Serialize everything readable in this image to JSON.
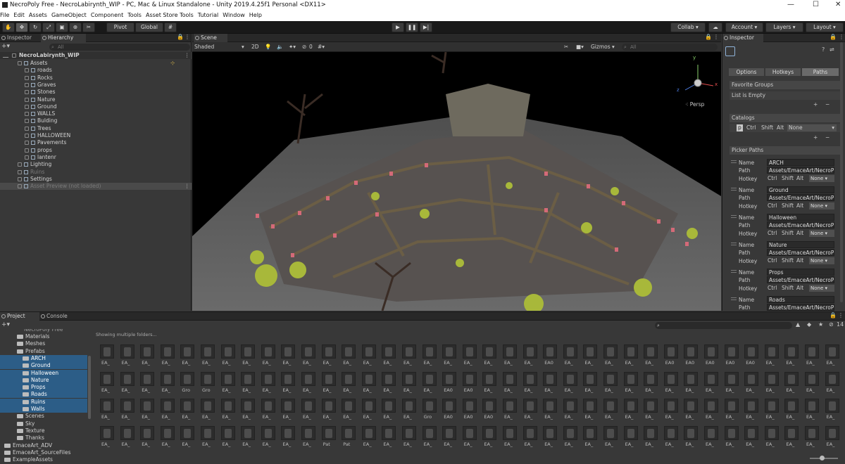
{
  "window": {
    "title": "NecroPoly Free - NecroLabirynth_WIP - PC, Mac & Linux Standalone - Unity 2019.4.25f1 Personal <DX11>"
  },
  "menu": [
    "File",
    "Edit",
    "Assets",
    "GameObject",
    "Component",
    "Tools",
    "Asset Store Tools",
    "Tutorial",
    "Window",
    "Help"
  ],
  "toolbar": {
    "pivot": "Pivot",
    "global": "Global",
    "collab": "Collab",
    "account": "Account",
    "layers": "Layers",
    "layout": "Layout"
  },
  "hierarchy": {
    "tabs": [
      "Inspector",
      "Hierarchy"
    ],
    "search_placeholder": "All",
    "scene": "NecroLabirynth_WIP",
    "items": [
      {
        "label": "Assets",
        "depth": 1
      },
      {
        "label": "roads",
        "depth": 2
      },
      {
        "label": "Rocks",
        "depth": 2
      },
      {
        "label": "Graves",
        "depth": 2
      },
      {
        "label": "Stones",
        "depth": 2
      },
      {
        "label": "Nature",
        "depth": 2
      },
      {
        "label": "Ground",
        "depth": 2
      },
      {
        "label": "WALLS",
        "depth": 2
      },
      {
        "label": "Bulding",
        "depth": 2
      },
      {
        "label": "Trees",
        "depth": 2
      },
      {
        "label": "HALLOWEEN",
        "depth": 2
      },
      {
        "label": "Pavements",
        "depth": 2
      },
      {
        "label": "props",
        "depth": 2
      },
      {
        "label": "lantenr",
        "depth": 2
      },
      {
        "label": "Lighting",
        "depth": 1
      },
      {
        "label": "Ruins",
        "depth": 1
      },
      {
        "label": "Settings",
        "depth": 1
      },
      {
        "label": "Asset Preview (not loaded)",
        "depth": 1
      }
    ]
  },
  "scene": {
    "tab": "Scene",
    "shading": "Shaded",
    "mode2d": "2D",
    "hidden_count": "0",
    "gizmos": "Gizmos",
    "search_placeholder": "All",
    "persp": "Persp",
    "axes": {
      "x": "x",
      "y": "y",
      "z": "z"
    }
  },
  "inspector": {
    "tab": "Inspector",
    "tabs": [
      "Options",
      "Hotkeys",
      "Paths"
    ],
    "favorite_groups": "Favorite Groups",
    "list_empty": "List is Empty",
    "catalogs": "Catalogs",
    "catalog_row": {
      "p": "p",
      "ctrl": "Ctrl",
      "shift": "Shift",
      "alt": "Alt",
      "none": "None"
    },
    "picker_paths": "Picker Paths",
    "labels": {
      "name": "Name",
      "path": "Path",
      "hotkey": "Hotkey"
    },
    "paths": [
      {
        "name": "ARCH",
        "path": "Assets/EmaceArt/NecroP"
      },
      {
        "name": "Ground",
        "path": "Assets/EmaceArt/NecroP"
      },
      {
        "name": "Halloween",
        "path": "Assets/EmaceArt/NecroP"
      },
      {
        "name": "Nature",
        "path": "Assets/EmaceArt/NecroP"
      },
      {
        "name": "Props",
        "path": "Assets/EmaceArt/NecroP"
      },
      {
        "name": "Roads",
        "path": "Assets/EmaceArt/NecroP"
      }
    ],
    "plus": "+",
    "minus": "−"
  },
  "project": {
    "tabs": [
      "Project",
      "Console"
    ],
    "status": "Showing multiple folders...",
    "count": "14",
    "tree": [
      {
        "label": "Materials",
        "depth": 3,
        "sel": false
      },
      {
        "label": "Meshes",
        "depth": 3,
        "sel": false
      },
      {
        "label": "Prefabs",
        "depth": 3,
        "sel": false
      },
      {
        "label": "ARCH",
        "depth": 4,
        "sel": true
      },
      {
        "label": "Ground",
        "depth": 4,
        "sel": true
      },
      {
        "label": "Halloween",
        "depth": 4,
        "sel": true
      },
      {
        "label": "Nature",
        "depth": 4,
        "sel": true
      },
      {
        "label": "Props",
        "depth": 4,
        "sel": true
      },
      {
        "label": "Roads",
        "depth": 4,
        "sel": true
      },
      {
        "label": "Ruins",
        "depth": 4,
        "sel": true
      },
      {
        "label": "Walls",
        "depth": 4,
        "sel": true
      },
      {
        "label": "Scenes",
        "depth": 3,
        "sel": false
      },
      {
        "label": "Sky",
        "depth": 3,
        "sel": false
      },
      {
        "label": "Texture",
        "depth": 3,
        "sel": false
      },
      {
        "label": "Thanks",
        "depth": 3,
        "sel": false
      },
      {
        "label": "EmaceArt_ADV",
        "depth": 1,
        "sel": false
      },
      {
        "label": "EmaceArt_SourceFiles",
        "depth": 1,
        "sel": false
      },
      {
        "label": "ExampleAssets",
        "depth": 1,
        "sel": false
      }
    ],
    "asset_rows": [
      [
        "EA_",
        "EA_",
        "EA_",
        "EA_",
        "EA_",
        "EA_",
        "EA_",
        "EA_",
        "EA_",
        "EA_",
        "EA_",
        "EA_",
        "EA_",
        "EA_",
        "EA_",
        "EA_",
        "EA_",
        "EA_",
        "EA_",
        "EA_",
        "EA_",
        "EA_",
        "EA0",
        "EA_",
        "EA_",
        "EA_",
        "EA_",
        "EA_",
        "EA0",
        "EA0",
        "EA0",
        "EA0",
        "EA0",
        "EA_",
        "EA_",
        "EA_",
        "EA_",
        "EA_"
      ],
      [
        "EA_",
        "EA_",
        "EA_",
        "EA_",
        "Gro",
        "Gro",
        "EA_",
        "EA_",
        "EA_",
        "EA_",
        "EA_",
        "EA_",
        "EA_",
        "EA_",
        "EA_",
        "EA_",
        "EA_",
        "EA0",
        "EA0",
        "EA_",
        "EA_",
        "EA_",
        "EA_",
        "EA_",
        "EA_",
        "EA_",
        "EA_",
        "EA_",
        "EA_",
        "EA_",
        "EA_",
        "EA_",
        "EA_",
        "EA_",
        "EA_",
        "EA_",
        "EA_",
        "EA_"
      ],
      [
        "EA_",
        "EA_",
        "EA_",
        "EA_",
        "EA_",
        "EA_",
        "EA_",
        "EA_",
        "EA_",
        "EA_",
        "EA_",
        "EA_",
        "EA_",
        "EA_",
        "EA_",
        "EA_",
        "Gro",
        "EA0",
        "EA0",
        "EA0",
        "EA_",
        "EA_",
        "EA_",
        "EA_",
        "EA_",
        "EA_",
        "EA_",
        "EA_",
        "EA_",
        "EA_",
        "EA_",
        "EA_",
        "EA_",
        "EA_",
        "EA_",
        "EA_",
        "EA_",
        "EA_"
      ],
      [
        "EA_",
        "EA_",
        "EA_",
        "EA_",
        "EA_",
        "EA_",
        "EA_",
        "EA_",
        "EA_",
        "EA_",
        "EA_",
        "Pat",
        "Pat",
        "EA_",
        "EA_",
        "EA_",
        "EA_",
        "EA_",
        "EA_",
        "EA_",
        "EA_",
        "EA_",
        "EA_",
        "EA_",
        "EA_",
        "EA_",
        "EA_",
        "EA_",
        "EA_",
        "EA_",
        "EA_",
        "EA_",
        "EA_",
        "EA_",
        "EA_",
        "EA_",
        "EA_",
        "EA_"
      ]
    ]
  }
}
